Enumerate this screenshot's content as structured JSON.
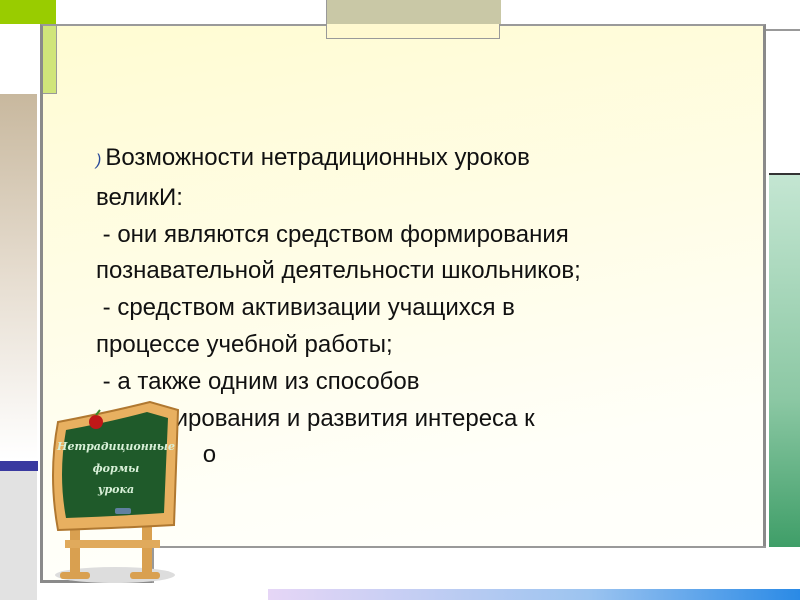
{
  "slide": {
    "bullet": ")",
    "lines": [
      "Возможности нетрадиционных уроков",
      "великИ:",
      " - они являются средством формирования",
      "познавательной деятельности школьников;",
      " - средством активизации учащихся в",
      "процессе учебной работы;",
      " - а также одним из способов",
      "стимулирования и развития интереса к",
      "                о"
    ],
    "board": [
      "Нетрадиционные",
      "формы",
      "урока"
    ]
  },
  "colors": {
    "accent_green": "#99cc00",
    "light_green": "#d0e57a",
    "khaki": "#c9c8a6",
    "blue": "#3a3aa0",
    "board": "#1f5a2a"
  }
}
